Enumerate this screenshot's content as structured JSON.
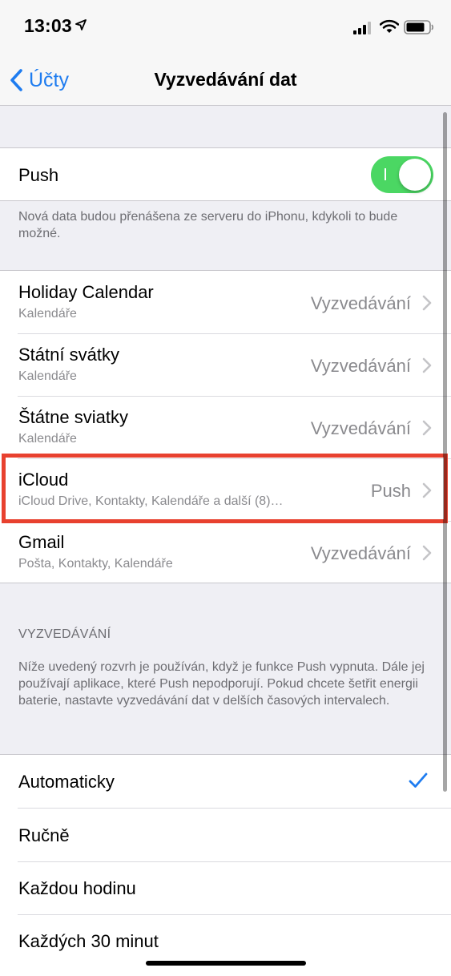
{
  "status_bar": {
    "time": "13:03",
    "icons": [
      "location-arrow-icon",
      "cellular-signal-icon",
      "wifi-icon",
      "battery-icon"
    ]
  },
  "nav": {
    "back_label": "Účty",
    "title": "Vyzvedávání dat"
  },
  "push": {
    "label": "Push",
    "enabled": true,
    "footer": "Nová data budou přenášena ze serveru do iPhonu, kdykoli to bude možné."
  },
  "accounts": [
    {
      "name": "Holiday Calendar",
      "detail": "Kalendáře",
      "value": "Vyzvedávání"
    },
    {
      "name": "Státní svátky",
      "detail": "Kalendáře",
      "value": "Vyzvedávání"
    },
    {
      "name": "Štátne sviatky",
      "detail": "Kalendáře",
      "value": "Vyzvedávání"
    },
    {
      "name": "iCloud",
      "detail": "iCloud Drive, Kontakty, Kalendáře a další (8)…",
      "value": "Push"
    },
    {
      "name": "Gmail",
      "detail": "Pošta, Kontakty, Kalendáře",
      "value": "Vyzvedávání"
    }
  ],
  "fetch": {
    "header": "VYZVEDÁVÁNÍ",
    "description": "Níže uvedený rozvrh je používán, když je funkce Push vypnuta. Dále jej používají aplikace, které Push nepodporují. Pokud chcete šetřit energii baterie, nastavte vyzvedávání dat v delších časových intervalech.",
    "options": [
      {
        "label": "Automaticky",
        "selected": true
      },
      {
        "label": "Ručně",
        "selected": false
      },
      {
        "label": "Každou hodinu",
        "selected": false
      },
      {
        "label": "Každých 30 minut",
        "selected": false
      }
    ]
  },
  "colors": {
    "accent": "#1e7cf0",
    "toggle_on": "#4bd763",
    "highlight": "#e8412f"
  }
}
